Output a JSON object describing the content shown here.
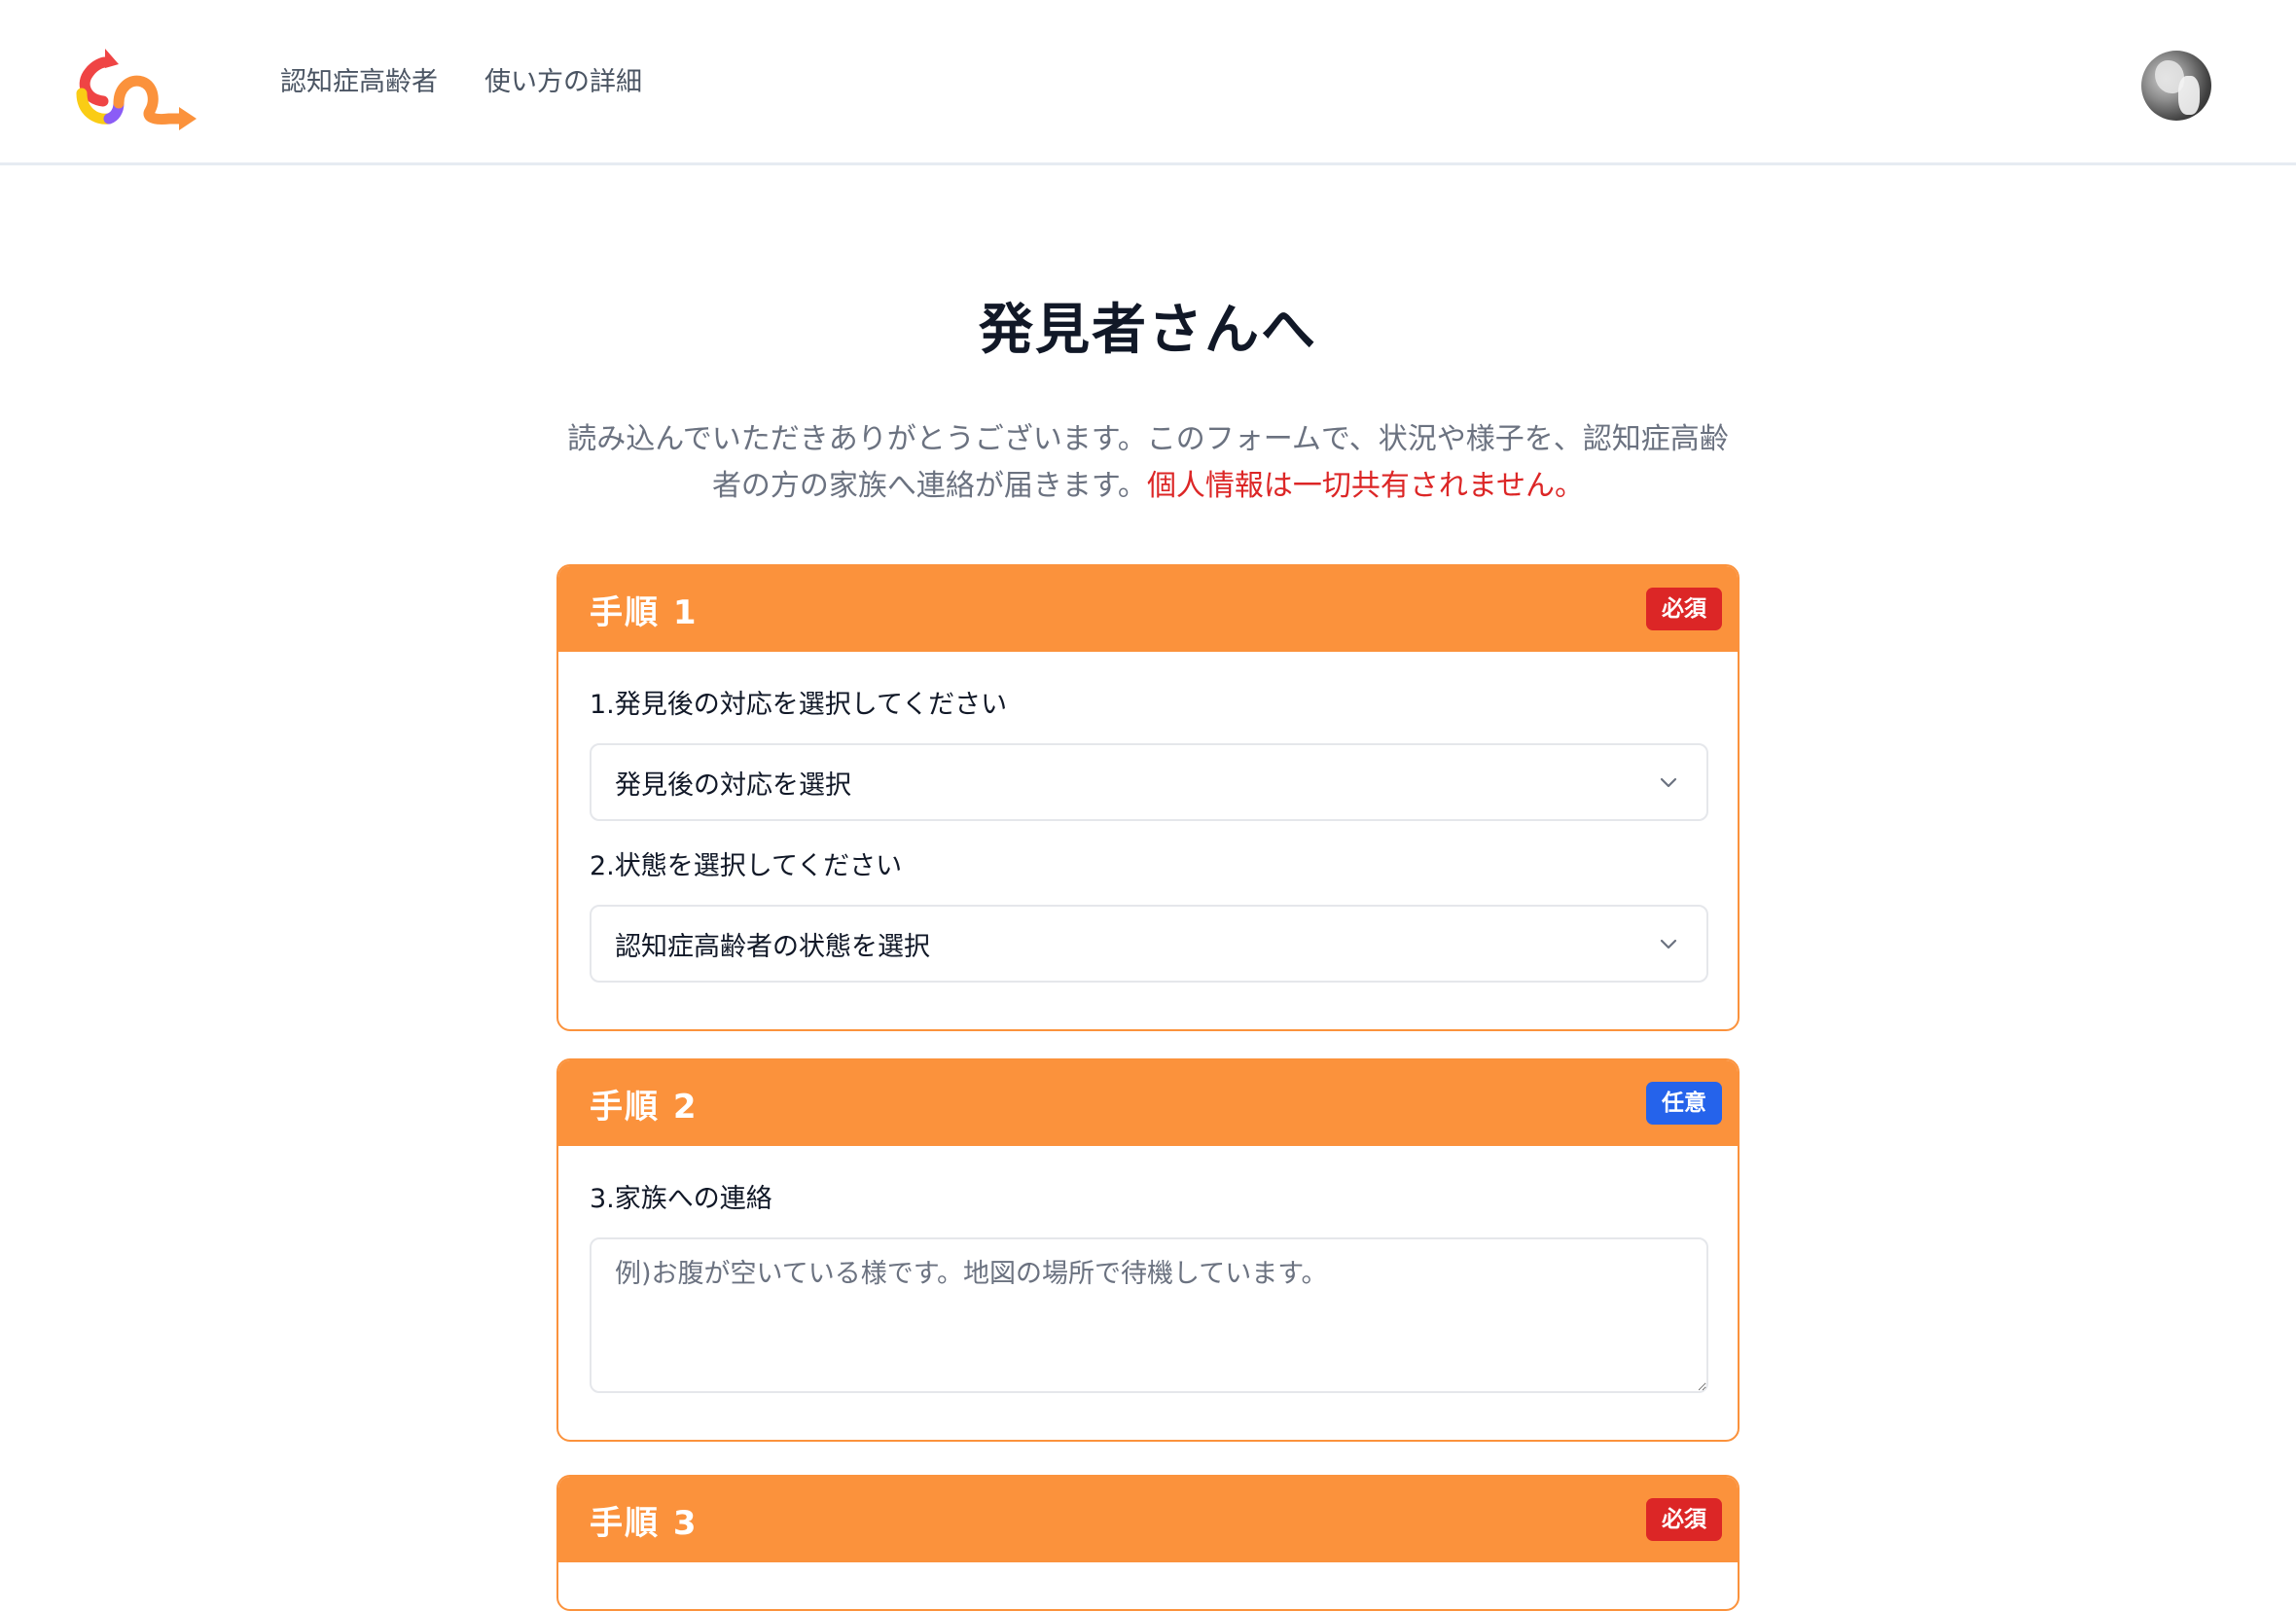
{
  "header": {
    "logo_icon": "app-logo-arrows",
    "nav": [
      {
        "label": "認知症高齢者"
      },
      {
        "label": "使い方の詳細"
      }
    ],
    "avatar_icon": "user-avatar"
  },
  "main": {
    "title": "発見者さんへ",
    "intro_text": "読み込んでいただきありがとうございます。このフォームで、状況や様子を、認知症高齢者の方の家族へ連絡が届きます。",
    "intro_warning": "個人情報は一切共有されません。"
  },
  "steps": [
    {
      "title": "手順 1",
      "badge": "必須",
      "fields": [
        {
          "label": "1.発見後の対応を選択してください",
          "selected": "発見後の対応を選択"
        },
        {
          "label": "2.状態を選択してください",
          "selected": "認知症高齢者の状態を選択"
        }
      ]
    },
    {
      "title": "手順 2",
      "badge": "任意",
      "fields": [
        {
          "label": "3.家族への連絡",
          "placeholder": "例)お腹が空いている様です。地図の場所で待機しています。",
          "value": ""
        }
      ]
    },
    {
      "title": "手順 3",
      "badge": "必須"
    }
  ],
  "colors": {
    "accent": "#fb923c",
    "required": "#dc2626",
    "optional": "#2563eb",
    "warning_text": "#dc2626"
  }
}
